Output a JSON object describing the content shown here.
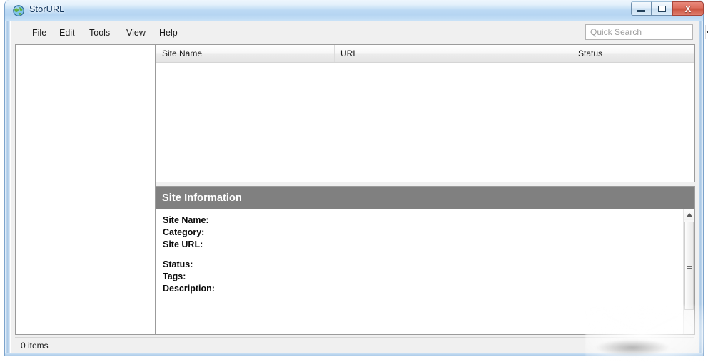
{
  "window": {
    "title": "StorURL",
    "icon": "globe-icon",
    "controls": {
      "minimize": "minimize-button",
      "maximize": "maximize-button",
      "close_glyph": "X"
    }
  },
  "menubar": {
    "items": [
      {
        "label": "File"
      },
      {
        "label": "Edit"
      },
      {
        "label": "Tools"
      },
      {
        "label": "View"
      },
      {
        "label": "Help"
      }
    ]
  },
  "search": {
    "value": "",
    "placeholder": "Quick Search",
    "dropdown_icon": "chevron-down-icon"
  },
  "sidebar": {
    "items": []
  },
  "list": {
    "columns": [
      {
        "label": "Site Name"
      },
      {
        "label": "URL"
      },
      {
        "label": "Status"
      },
      {
        "label": ""
      }
    ],
    "rows": []
  },
  "info": {
    "title": "Site Information",
    "groups": [
      {
        "fields": [
          {
            "label": "Site Name:",
            "value": ""
          },
          {
            "label": "Category:",
            "value": ""
          },
          {
            "label": "Site URL:",
            "value": ""
          }
        ]
      },
      {
        "fields": [
          {
            "label": "Status:",
            "value": ""
          },
          {
            "label": "Tags:",
            "value": ""
          },
          {
            "label": "Description:",
            "value": ""
          }
        ]
      }
    ],
    "scroll_up_icon": "triangle-up-icon"
  },
  "statusbar": {
    "text": "0 items"
  },
  "colors": {
    "titlebar_text": "#12355c",
    "info_header_bg": "#808080",
    "close_button": "#cf5540",
    "window_border": "#7ba3cc",
    "client_bg": "#f0f0f0"
  }
}
